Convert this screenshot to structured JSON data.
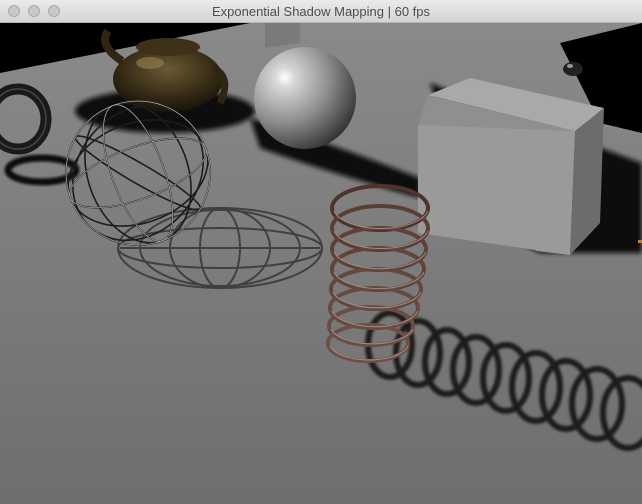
{
  "window": {
    "title": "Exponential Shadow Mapping | 60 fps"
  },
  "scene": {
    "objects": [
      "teapot",
      "sphere",
      "wireframe-sphere",
      "torus",
      "cube",
      "spring-coil",
      "floor-plane"
    ],
    "colors": {
      "floor": "#7d7d7d",
      "background": "#000000",
      "shadow": "#1a1a1a",
      "coil": "#5a4038",
      "teapot": "#3a2f17"
    }
  }
}
